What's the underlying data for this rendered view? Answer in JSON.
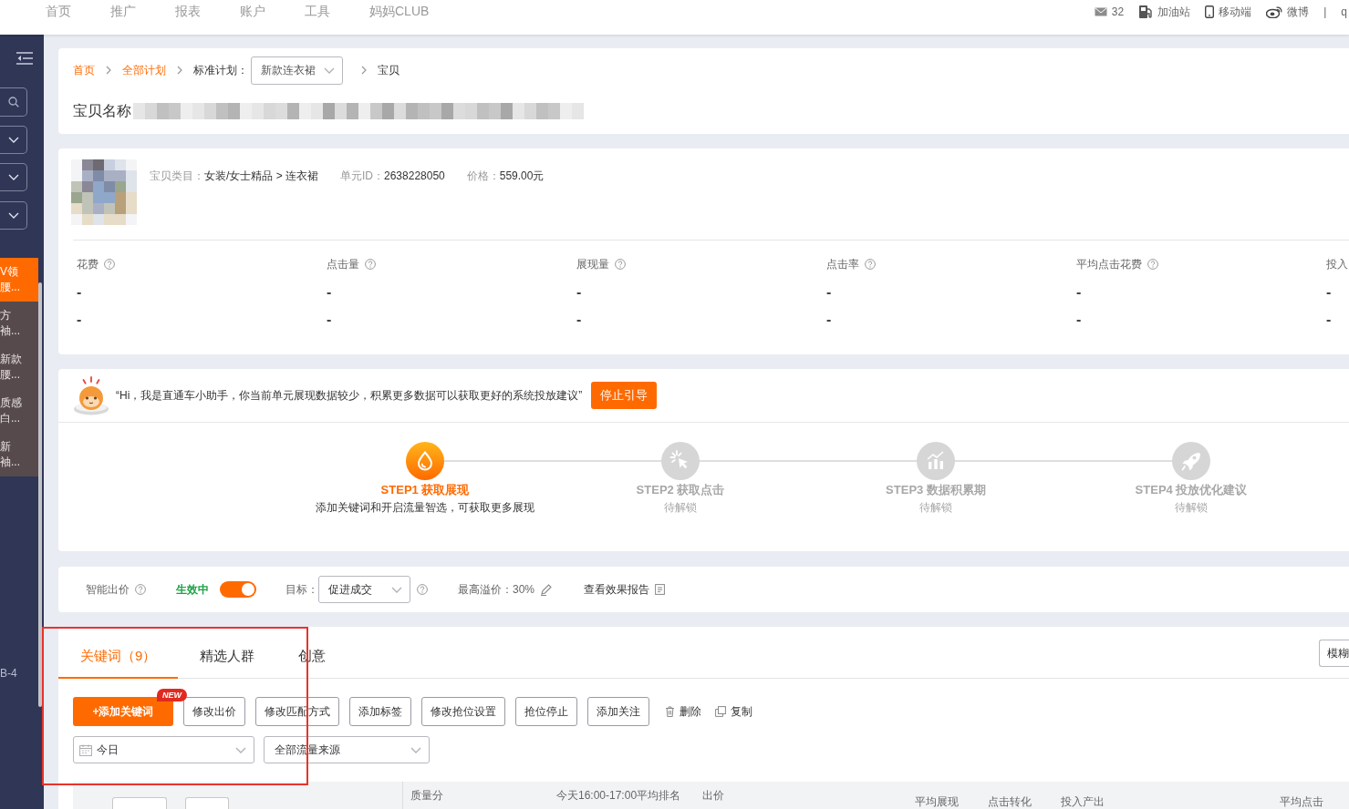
{
  "top_nav": {
    "items": [
      "首页",
      "推广",
      "报表",
      "账户",
      "工具",
      "妈妈CLUB"
    ],
    "links": [
      {
        "kind": "mail",
        "label": "32"
      },
      {
        "kind": "fuel",
        "label": "加油站"
      },
      {
        "kind": "mobile",
        "label": "移动端"
      },
      {
        "kind": "weibo",
        "label": "微博"
      }
    ],
    "separator": "|",
    "cut_text": "q"
  },
  "sidebar": {
    "items": [
      {
        "lines": [
          "V领",
          "腰..."
        ],
        "selected": true
      },
      {
        "lines": [
          "方",
          "袖..."
        ],
        "selected": false
      },
      {
        "lines": [
          "新款",
          "腰..."
        ],
        "selected": false
      },
      {
        "lines": [
          "质感",
          "白..."
        ],
        "selected": false
      },
      {
        "lines": [
          "新",
          "袖..."
        ],
        "selected": false
      }
    ],
    "footer_text": "B-4"
  },
  "header_card": {
    "breadcrumb": [
      {
        "kind": "link",
        "label": "首页"
      },
      {
        "kind": "link",
        "label": "全部计划"
      },
      {
        "kind": "select",
        "label": "标准计划：",
        "value": "新款连衣裙"
      },
      {
        "kind": "text",
        "label": "宝贝"
      }
    ],
    "title": "宝贝名称"
  },
  "product": {
    "fields": [
      {
        "label": "宝贝类目：",
        "value": "女装/女士精品 > 连衣裙"
      },
      {
        "label": "单元ID：",
        "value": "2638228050"
      },
      {
        "label": "价格：",
        "value": "559.00元"
      }
    ]
  },
  "metrics": [
    {
      "label": "花费",
      "help": true,
      "values": [
        "-",
        "-"
      ]
    },
    {
      "label": "点击量",
      "help": true,
      "values": [
        "-",
        "-"
      ]
    },
    {
      "label": "展现量",
      "help": true,
      "values": [
        "-",
        "-"
      ]
    },
    {
      "label": "点击率",
      "help": true,
      "values": [
        "-",
        "-"
      ]
    },
    {
      "label": "平均点击花费",
      "help": true,
      "values": [
        "-",
        "-"
      ]
    },
    {
      "label": "投入",
      "help": false,
      "values": [
        "-",
        "-"
      ]
    }
  ],
  "assistant": {
    "message": "“Hi，我是直通车小助手，你当前单元展现数据较少，积累更多数据可以获取更好的系统投放建议”",
    "button": "停止引导"
  },
  "steps": [
    {
      "kind": "drop",
      "title": "STEP1 获取展现",
      "note": "添加关键词和开启流量智选，可获取更多展现",
      "active": true
    },
    {
      "kind": "click",
      "title": "STEP2 获取点击",
      "note": "待解锁",
      "active": false
    },
    {
      "kind": "chart",
      "title": "STEP3 数据积累期",
      "note": "待解锁",
      "active": false
    },
    {
      "kind": "rocket",
      "title": "STEP4 投放优化建议",
      "note": "待解锁",
      "active": false
    }
  ],
  "smart_bid": {
    "label": "智能出价",
    "status": "生效中",
    "on": true,
    "goal_label": "目标：",
    "goal": "促进成交",
    "max_premium": "最高溢价：30%",
    "report_link": "查看效果报告"
  },
  "keyword_panel": {
    "tabs": [
      {
        "label": "关键词（9）",
        "selected": true
      },
      {
        "label": "精选人群",
        "selected": false
      },
      {
        "label": "创意",
        "selected": false
      }
    ],
    "side_button": "模糊",
    "actions": [
      {
        "kind": "primary",
        "label": "+添加关键词",
        "badge": "NEW"
      },
      {
        "kind": "outline",
        "label": "修改出价"
      },
      {
        "kind": "outline",
        "label": "修改匹配方式"
      },
      {
        "kind": "outline",
        "label": "添加标签"
      },
      {
        "kind": "outline",
        "label": "修改抢位设置"
      },
      {
        "kind": "outline",
        "label": "抢位停止"
      },
      {
        "kind": "outline",
        "label": "添加关注"
      },
      {
        "kind": "delete",
        "label": "删除"
      },
      {
        "kind": "copy",
        "label": "复制"
      }
    ],
    "filters": [
      {
        "kind": "date",
        "value": "今日"
      },
      {
        "kind": "select",
        "value": "全部流量来源"
      }
    ],
    "table": {
      "columns": [
        "质量分",
        "今天16:00-17:00平均排名",
        "出价",
        "平均展现",
        "点击转化",
        "投入产出",
        "平均点击"
      ]
    }
  }
}
